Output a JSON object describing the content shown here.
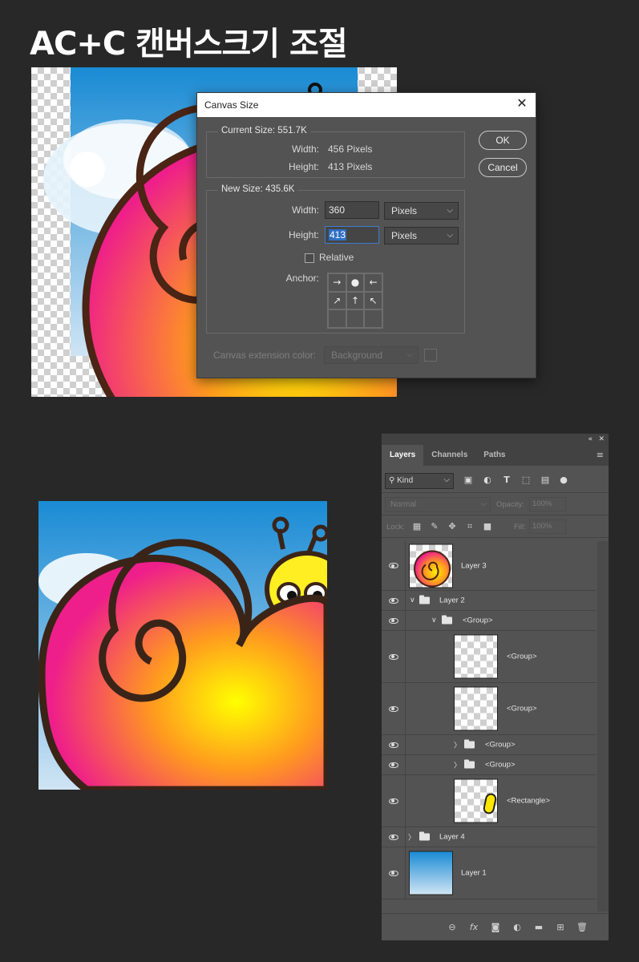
{
  "page_title": "AC+C 캔버스크기 조절",
  "dialog": {
    "title": "Canvas Size",
    "close_icon": "close-icon",
    "current_size": {
      "legend": "Current Size: 551.7K",
      "width_label": "Width:",
      "width_value": "456 Pixels",
      "height_label": "Height:",
      "height_value": "413 Pixels"
    },
    "new_size": {
      "legend": "New Size: 435.6K",
      "width_label": "Width:",
      "width_value": "360",
      "width_unit": "Pixels",
      "height_label": "Height:",
      "height_value": "413",
      "height_unit": "Pixels",
      "relative_label": "Relative",
      "relative_checked": false,
      "anchor_label": "Anchor:"
    },
    "extension": {
      "label": "Canvas extension color:",
      "value": "Background"
    },
    "ok_label": "OK",
    "cancel_label": "Cancel"
  },
  "layers_panel": {
    "tabs": [
      {
        "label": "Layers",
        "active": true
      },
      {
        "label": "Channels",
        "active": false
      },
      {
        "label": "Paths",
        "active": false
      }
    ],
    "filter_kind": "Kind",
    "blend_mode": "Normal",
    "opacity_label": "Opacity:",
    "opacity_value": "100%",
    "lock_label": "Lock:",
    "fill_label": "Fill:",
    "fill_value": "100%",
    "layers": [
      {
        "name": "Layer 3"
      },
      {
        "name": "Layer 2"
      },
      {
        "name": "<Group>"
      },
      {
        "name": "<Group>"
      },
      {
        "name": "<Group>"
      },
      {
        "name": "<Group>"
      },
      {
        "name": "<Group>"
      },
      {
        "name": "<Rectangle>"
      },
      {
        "name": "Layer 4"
      },
      {
        "name": "Layer 1"
      }
    ]
  },
  "colors": {
    "background": "#282828",
    "dialog_bg": "#535353",
    "panel_bg": "#535353",
    "selection_blue": "#2f6fc4"
  }
}
